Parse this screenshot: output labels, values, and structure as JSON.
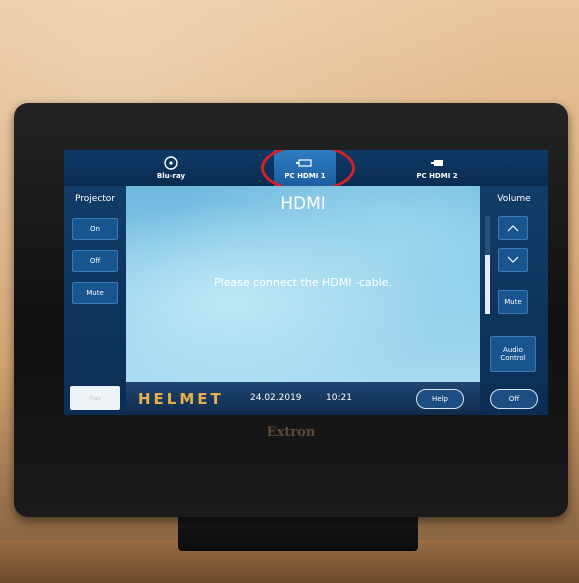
{
  "sources": [
    {
      "label": "Blu-ray",
      "icon": "disc-icon",
      "active": false
    },
    {
      "label": "PC HDMI 1",
      "icon": "hdmi-icon",
      "active": true
    },
    {
      "label": "PC HDMI 2",
      "icon": "hdmi-icon",
      "active": false
    }
  ],
  "projector": {
    "title": "Projector",
    "on": "On",
    "off": "Off",
    "mute": "Mute"
  },
  "volume": {
    "title": "Volume",
    "mute": "Mute",
    "audio_control": "Audio Control",
    "level": 0.6
  },
  "content": {
    "title": "HDMI",
    "message": "Please connect the HDMI -cable."
  },
  "bottom": {
    "logo": "HELMET",
    "date": "24.02.2019",
    "time": "10:21",
    "help": "Help",
    "off": "Off"
  },
  "corner_box": {
    "label": "Hav"
  },
  "device": {
    "brand": "Extron"
  },
  "colors": {
    "accent": "#1d5d9f",
    "highlight_ring": "#d61f26",
    "logo": "#e8b04a"
  }
}
